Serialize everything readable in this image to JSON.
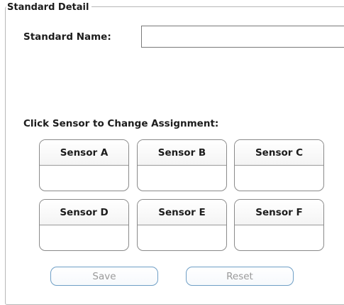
{
  "panel": {
    "title": "Standard Detail"
  },
  "standard_name": {
    "label": "Standard Name:",
    "value": ""
  },
  "sensors": {
    "heading": "Click Sensor to Change Assignment:",
    "items": [
      {
        "label": "Sensor A",
        "assignment": ""
      },
      {
        "label": "Sensor B",
        "assignment": ""
      },
      {
        "label": "Sensor C",
        "assignment": ""
      },
      {
        "label": "Sensor D",
        "assignment": ""
      },
      {
        "label": "Sensor E",
        "assignment": ""
      },
      {
        "label": "Sensor F",
        "assignment": ""
      }
    ]
  },
  "actions": {
    "save_label": "Save",
    "reset_label": "Reset",
    "disabled_text_color": "#9a9a9a",
    "border_color": "#6f9fc6"
  }
}
